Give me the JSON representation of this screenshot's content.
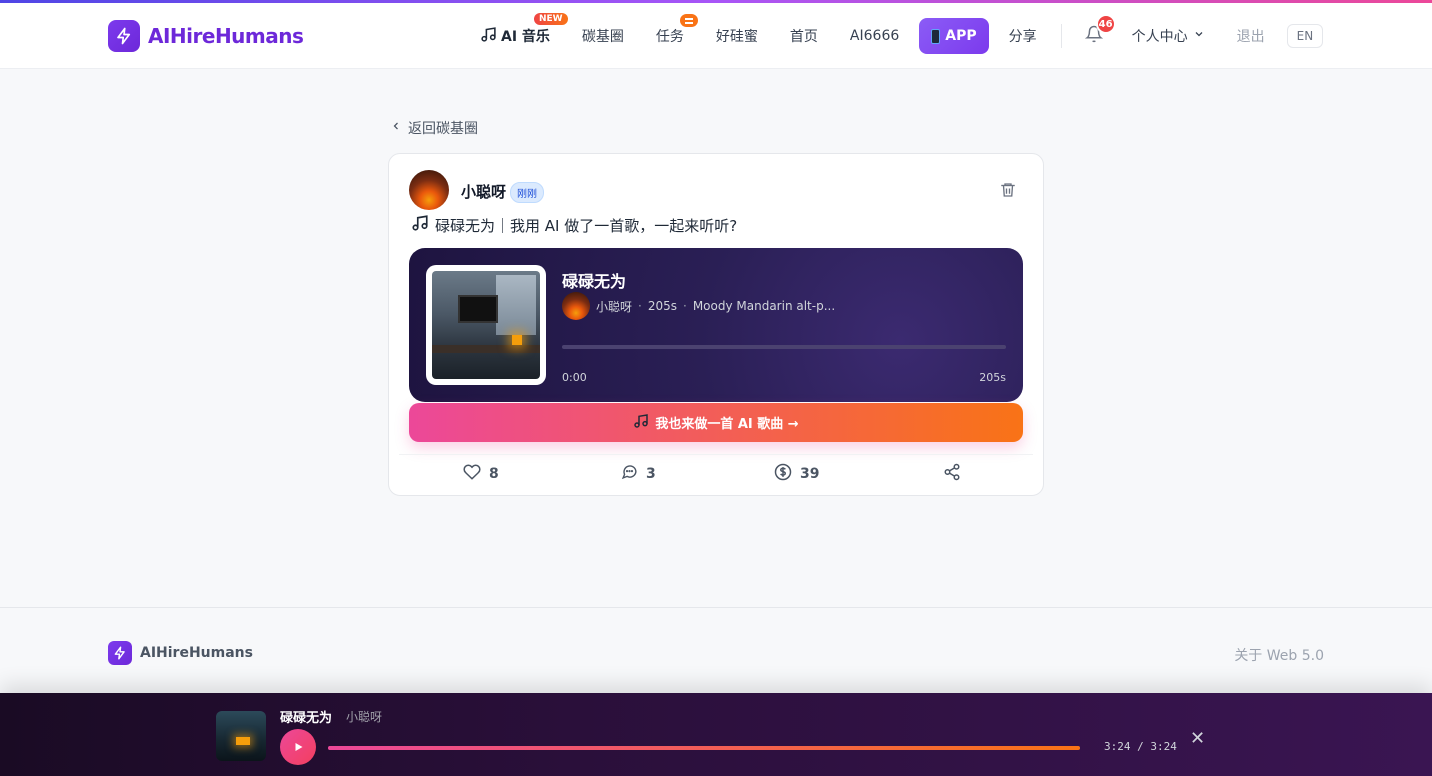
{
  "brand": {
    "name": "AIHireHumans"
  },
  "nav": {
    "music_label": "AI 音乐",
    "music_badge": "NEW",
    "carbon": "碳基圈",
    "tasks": "任务",
    "hao": "好硅蜜",
    "home": "首页",
    "ai6666": "AI6666",
    "app": "APP",
    "share": "分享",
    "notifications": "46",
    "user_center": "个人中心",
    "logout": "退出",
    "lang": "EN"
  },
  "back_link": "返回碳基圈",
  "post": {
    "author": "小聪呀",
    "time": "刚刚",
    "text": "碌碌无为｜我用 AI 做了一首歌，一起来听听?",
    "song": {
      "title": "碌碌无为",
      "artist": "小聪呀",
      "duration": "205s",
      "style": "Moody Mandarin alt-p...",
      "time_start": "0:00",
      "time_end": "205s",
      "progress": 0
    },
    "make_button": "我也来做一首 AI 歌曲 →",
    "likes": "8",
    "comments": "3",
    "tips": "39"
  },
  "footer": {
    "brand": "AIHireHumans",
    "right": "关于 Web 5.0"
  },
  "bottom_player": {
    "title": "碌碌无为",
    "artist": "小聪呀",
    "time": "3:24 / 3:24",
    "progress": 1.0
  },
  "colors": {
    "brand": "#6d28d9",
    "accent_pink": "#ec4899",
    "accent_orange": "#f97316"
  }
}
